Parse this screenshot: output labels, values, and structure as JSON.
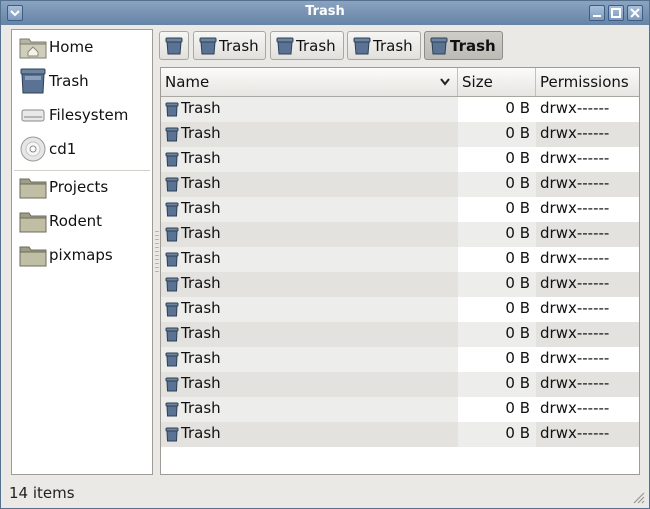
{
  "window": {
    "title": "Trash"
  },
  "sidebar": {
    "items": [
      {
        "label": "Home",
        "icon": "home-folder-icon"
      },
      {
        "label": "Trash",
        "icon": "trash-icon"
      },
      {
        "label": "Filesystem",
        "icon": "drive-icon"
      },
      {
        "label": "cd1",
        "icon": "cdrom-icon"
      }
    ],
    "bookmarks": [
      {
        "label": "Projects",
        "icon": "folder-icon"
      },
      {
        "label": "Rodent",
        "icon": "folder-icon"
      },
      {
        "label": "pixmaps",
        "icon": "folder-icon"
      }
    ]
  },
  "pathbar": {
    "buttons": [
      "",
      "Trash",
      "Trash",
      "Trash",
      "Trash"
    ],
    "active_index": 4
  },
  "columns": {
    "name": "Name",
    "size": "Size",
    "permissions": "Permissions"
  },
  "files": [
    {
      "name": "Trash",
      "size": "0 B",
      "perm": "drwx------"
    },
    {
      "name": "Trash",
      "size": "0 B",
      "perm": "drwx------"
    },
    {
      "name": "Trash",
      "size": "0 B",
      "perm": "drwx------"
    },
    {
      "name": "Trash",
      "size": "0 B",
      "perm": "drwx------"
    },
    {
      "name": "Trash",
      "size": "0 B",
      "perm": "drwx------"
    },
    {
      "name": "Trash",
      "size": "0 B",
      "perm": "drwx------"
    },
    {
      "name": "Trash",
      "size": "0 B",
      "perm": "drwx------"
    },
    {
      "name": "Trash",
      "size": "0 B",
      "perm": "drwx------"
    },
    {
      "name": "Trash",
      "size": "0 B",
      "perm": "drwx------"
    },
    {
      "name": "Trash",
      "size": "0 B",
      "perm": "drwx------"
    },
    {
      "name": "Trash",
      "size": "0 B",
      "perm": "drwx------"
    },
    {
      "name": "Trash",
      "size": "0 B",
      "perm": "drwx------"
    },
    {
      "name": "Trash",
      "size": "0 B",
      "perm": "drwx------"
    },
    {
      "name": "Trash",
      "size": "0 B",
      "perm": "drwx------"
    }
  ],
  "status": {
    "text": "14 items"
  },
  "colors": {
    "titlebar": "#7592b4",
    "selection": "#c8c6c0",
    "row_alt": "#e3e2de"
  }
}
